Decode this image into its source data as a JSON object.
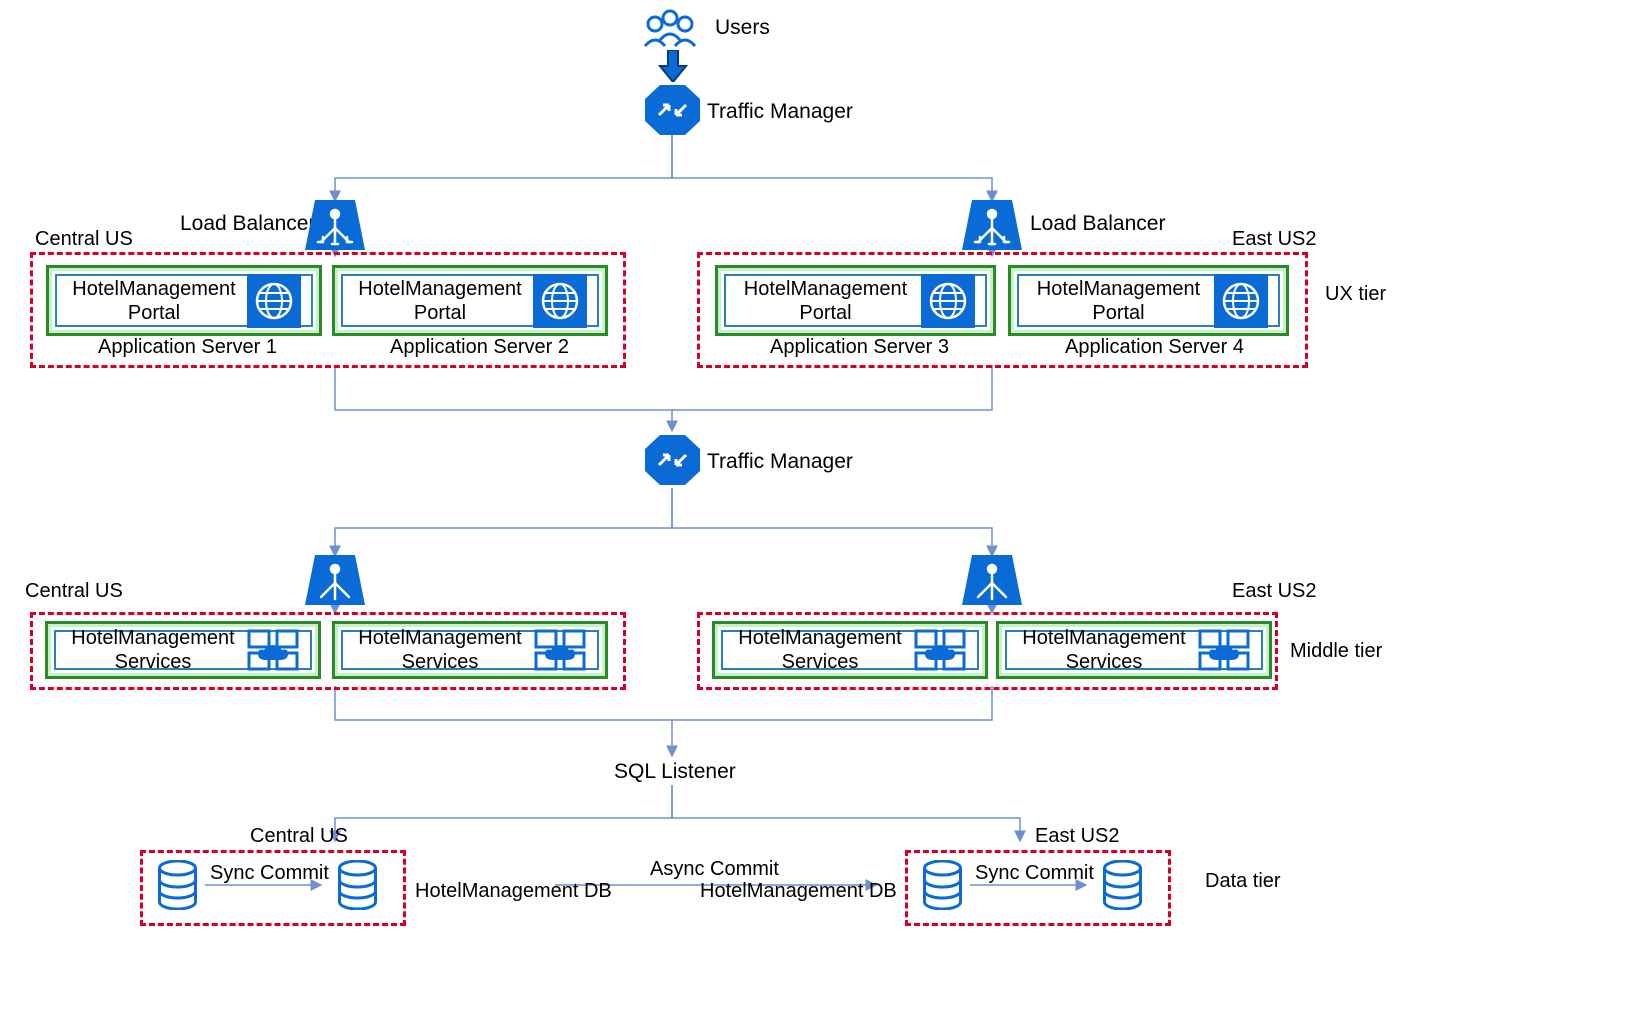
{
  "labels": {
    "users": "Users",
    "traffic_manager": "Traffic Manager",
    "load_balancer": "Load Balancer",
    "central_us": "Central US",
    "east_us2": "East US2",
    "ux_tier": "UX tier",
    "middle_tier": "Middle tier",
    "data_tier": "Data tier",
    "sql_listener": "SQL Listener",
    "sync_commit": "Sync Commit",
    "async_commit": "Async Commit",
    "hm_db": "HotelManagement DB",
    "hm_portal": "HotelManagement\nPortal",
    "hm_services": "HotelManagement\nServices",
    "app_server_1": "Application Server 1",
    "app_server_2": "Application Server 2",
    "app_server_3": "Application Server 3",
    "app_server_4": "Application Server 4"
  },
  "colors": {
    "region_border": "#d4002a",
    "server_border": "#2a8a2a",
    "azure_blue": "#0a6bd6",
    "wire": "#6f8fd0"
  }
}
